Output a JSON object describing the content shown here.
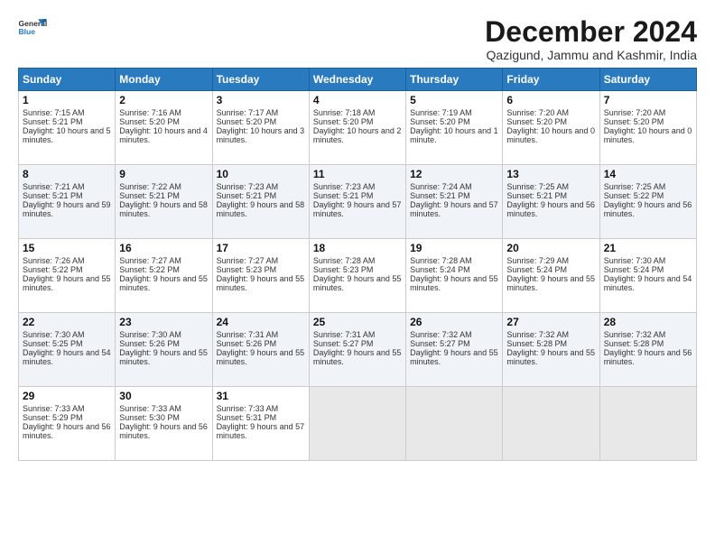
{
  "logo": {
    "line1": "General",
    "line2": "Blue"
  },
  "title": "December 2024",
  "subtitle": "Qazigund, Jammu and Kashmir, India",
  "days": [
    "Sunday",
    "Monday",
    "Tuesday",
    "Wednesday",
    "Thursday",
    "Friday",
    "Saturday"
  ],
  "weeks": [
    [
      {
        "day": "1",
        "sunrise": "7:15 AM",
        "sunset": "5:21 PM",
        "daylight": "10 hours and 5 minutes."
      },
      {
        "day": "2",
        "sunrise": "7:16 AM",
        "sunset": "5:20 PM",
        "daylight": "10 hours and 4 minutes."
      },
      {
        "day": "3",
        "sunrise": "7:17 AM",
        "sunset": "5:20 PM",
        "daylight": "10 hours and 3 minutes."
      },
      {
        "day": "4",
        "sunrise": "7:18 AM",
        "sunset": "5:20 PM",
        "daylight": "10 hours and 2 minutes."
      },
      {
        "day": "5",
        "sunrise": "7:19 AM",
        "sunset": "5:20 PM",
        "daylight": "10 hours and 1 minute."
      },
      {
        "day": "6",
        "sunrise": "7:20 AM",
        "sunset": "5:20 PM",
        "daylight": "10 hours and 0 minutes."
      },
      {
        "day": "7",
        "sunrise": "7:20 AM",
        "sunset": "5:20 PM",
        "daylight": "10 hours and 0 minutes."
      }
    ],
    [
      {
        "day": "8",
        "sunrise": "7:21 AM",
        "sunset": "5:21 PM",
        "daylight": "9 hours and 59 minutes."
      },
      {
        "day": "9",
        "sunrise": "7:22 AM",
        "sunset": "5:21 PM",
        "daylight": "9 hours and 58 minutes."
      },
      {
        "day": "10",
        "sunrise": "7:23 AM",
        "sunset": "5:21 PM",
        "daylight": "9 hours and 58 minutes."
      },
      {
        "day": "11",
        "sunrise": "7:23 AM",
        "sunset": "5:21 PM",
        "daylight": "9 hours and 57 minutes."
      },
      {
        "day": "12",
        "sunrise": "7:24 AM",
        "sunset": "5:21 PM",
        "daylight": "9 hours and 57 minutes."
      },
      {
        "day": "13",
        "sunrise": "7:25 AM",
        "sunset": "5:21 PM",
        "daylight": "9 hours and 56 minutes."
      },
      {
        "day": "14",
        "sunrise": "7:25 AM",
        "sunset": "5:22 PM",
        "daylight": "9 hours and 56 minutes."
      }
    ],
    [
      {
        "day": "15",
        "sunrise": "7:26 AM",
        "sunset": "5:22 PM",
        "daylight": "9 hours and 55 minutes."
      },
      {
        "day": "16",
        "sunrise": "7:27 AM",
        "sunset": "5:22 PM",
        "daylight": "9 hours and 55 minutes."
      },
      {
        "day": "17",
        "sunrise": "7:27 AM",
        "sunset": "5:23 PM",
        "daylight": "9 hours and 55 minutes."
      },
      {
        "day": "18",
        "sunrise": "7:28 AM",
        "sunset": "5:23 PM",
        "daylight": "9 hours and 55 minutes."
      },
      {
        "day": "19",
        "sunrise": "7:28 AM",
        "sunset": "5:24 PM",
        "daylight": "9 hours and 55 minutes."
      },
      {
        "day": "20",
        "sunrise": "7:29 AM",
        "sunset": "5:24 PM",
        "daylight": "9 hours and 55 minutes."
      },
      {
        "day": "21",
        "sunrise": "7:30 AM",
        "sunset": "5:24 PM",
        "daylight": "9 hours and 54 minutes."
      }
    ],
    [
      {
        "day": "22",
        "sunrise": "7:30 AM",
        "sunset": "5:25 PM",
        "daylight": "9 hours and 54 minutes."
      },
      {
        "day": "23",
        "sunrise": "7:30 AM",
        "sunset": "5:26 PM",
        "daylight": "9 hours and 55 minutes."
      },
      {
        "day": "24",
        "sunrise": "7:31 AM",
        "sunset": "5:26 PM",
        "daylight": "9 hours and 55 minutes."
      },
      {
        "day": "25",
        "sunrise": "7:31 AM",
        "sunset": "5:27 PM",
        "daylight": "9 hours and 55 minutes."
      },
      {
        "day": "26",
        "sunrise": "7:32 AM",
        "sunset": "5:27 PM",
        "daylight": "9 hours and 55 minutes."
      },
      {
        "day": "27",
        "sunrise": "7:32 AM",
        "sunset": "5:28 PM",
        "daylight": "9 hours and 55 minutes."
      },
      {
        "day": "28",
        "sunrise": "7:32 AM",
        "sunset": "5:28 PM",
        "daylight": "9 hours and 56 minutes."
      }
    ],
    [
      {
        "day": "29",
        "sunrise": "7:33 AM",
        "sunset": "5:29 PM",
        "daylight": "9 hours and 56 minutes."
      },
      {
        "day": "30",
        "sunrise": "7:33 AM",
        "sunset": "5:30 PM",
        "daylight": "9 hours and 56 minutes."
      },
      {
        "day": "31",
        "sunrise": "7:33 AM",
        "sunset": "5:31 PM",
        "daylight": "9 hours and 57 minutes."
      },
      null,
      null,
      null,
      null
    ]
  ]
}
